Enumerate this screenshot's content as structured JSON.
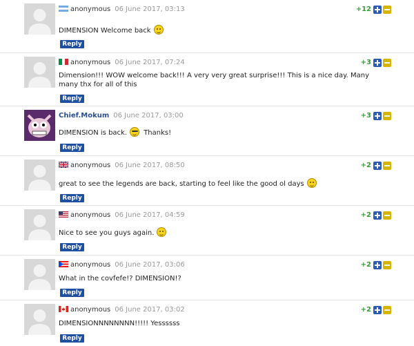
{
  "reply_label": "Reply",
  "comments": [
    {
      "user": "anonymous",
      "date": "06 June 2017, 03:13",
      "score": "+12",
      "text": "DIMENSION Welcome back",
      "flag": "argentina-flag",
      "emoji": "grin"
    },
    {
      "user": "anonymous",
      "date": "06 June 2017, 07:24",
      "score": "+3",
      "text": "Dimension!!! WOW welcome back!!! A very very great surprise!!! This is a nice day. Many many thx for all of this",
      "flag": "italy-flag",
      "emoji": ""
    },
    {
      "user": "Chief.Mokum",
      "date": "06 June 2017, 03:00",
      "score": "+3",
      "text": "DIMENSION is back.",
      "text2": "Thanks!",
      "flag": "",
      "emoji": "cool"
    },
    {
      "user": "anonymous",
      "date": "06 June 2017, 08:50",
      "score": "+2",
      "text": "great to see the legends are back, starting to feel like the good ol days",
      "flag": "uk-flag",
      "emoji": "smile"
    },
    {
      "user": "anonymous",
      "date": "06 June 2017, 04:59",
      "score": "+2",
      "text": "Nice to see you guys again.",
      "flag": "us-flag",
      "emoji": "smile"
    },
    {
      "user": "anonymous",
      "date": "06 June 2017, 03:06",
      "score": "+2",
      "text": "What in the covfefe!? DIMENSION!?",
      "flag": "puerto-rico-flag",
      "emoji": ""
    },
    {
      "user": "anonymous",
      "date": "06 June 2017, 03:02",
      "score": "+2",
      "text": "DIMENSIONNNNNNNN!!!!! Yessssss",
      "flag": "canada-flag",
      "emoji": ""
    }
  ],
  "colors": {
    "score": "#3a9a3a",
    "reply_bg": "#1e4fa0",
    "registered_user": "#2a4f95",
    "upvote": "#2a5bb8",
    "downvote": "#d6b400"
  }
}
